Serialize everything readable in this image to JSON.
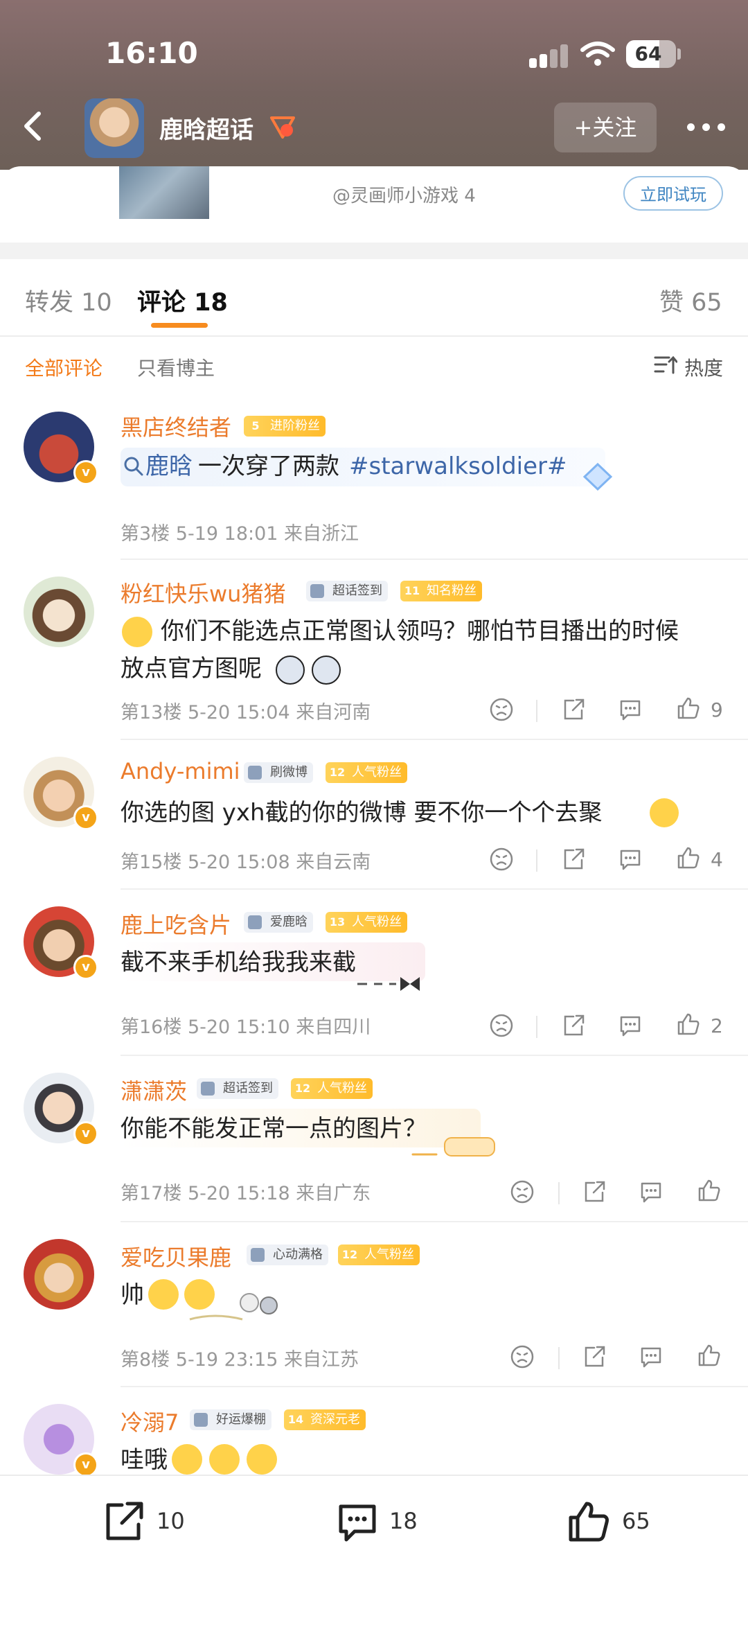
{
  "status_bar": {
    "time": "16:10",
    "battery": "64"
  },
  "header": {
    "title": "鹿晗超话",
    "follow_label": "+关注"
  },
  "ad": {
    "source": "@灵画师小游戏 4",
    "cta": "立即试玩"
  },
  "tabs": {
    "repost": "转发 10",
    "comments": "评论 18",
    "likes": "赞 65"
  },
  "filters": {
    "all": "全部评论",
    "owner_only": "只看博主",
    "sort": "热度"
  },
  "comments": [
    {
      "user": "黑店终结者",
      "fan_level": "5",
      "fan_title": "进阶粉丝",
      "topic": "鹿晗",
      "text": "一次穿了两款",
      "hashtag": "#starwalksoldier#",
      "floor": "第3楼",
      "date": "5-19 18:01",
      "location": "来自浙江"
    },
    {
      "user": "粉红快乐wu猪猪",
      "tag": "超话签到",
      "fan_level": "11",
      "fan_title": "知名粉丝",
      "text_line1": "你们不能选点正常图认领吗？哪怕节目播出的时候",
      "text_line2": "放点官方图呢",
      "floor": "第13楼",
      "date": "5-20 15:04",
      "location": "来自河南",
      "likes": "9"
    },
    {
      "user": "Andy-mimi",
      "tag": "刷微博",
      "fan_level": "12",
      "fan_title": "人气粉丝",
      "text": "你选的图  yxh截的你的微博  要不你一个个去聚",
      "floor": "第15楼",
      "date": "5-20 15:08",
      "location": "来自云南",
      "likes": "4"
    },
    {
      "user": "鹿上吃含片",
      "tag": "爱鹿晗",
      "fan_level": "13",
      "fan_title": "人气粉丝",
      "text": "截不来手机给我我来截",
      "floor": "第16楼",
      "date": "5-20 15:10",
      "location": "来自四川",
      "likes": "2"
    },
    {
      "user": "潇潇茨",
      "tag": "超话签到",
      "fan_level": "12",
      "fan_title": "人气粉丝",
      "text": "你能不能发正常一点的图片？",
      "floor": "第17楼",
      "date": "5-20 15:18",
      "location": "来自广东"
    },
    {
      "user": "爱吃贝果鹿",
      "tag": "心动满格",
      "fan_level": "12",
      "fan_title": "人气粉丝",
      "text": "帅",
      "floor": "第8楼",
      "date": "5-19 23:15",
      "location": "来自江苏"
    },
    {
      "user": "冷溺7",
      "tag": "好运爆棚",
      "fan_level": "14",
      "fan_title": "资深元老",
      "text": "哇哦"
    }
  ],
  "bottom_bar": {
    "reposts": "10",
    "comments": "18",
    "likes": "65"
  },
  "colors": {
    "accent": "#f37a18",
    "username": "#eb7b2c",
    "badge": "#ffc53a"
  },
  "icons": [
    "back-arrow-icon",
    "more-dots-icon",
    "sort-icon",
    "dislike-icon",
    "share-icon",
    "reply-icon",
    "like-icon"
  ]
}
